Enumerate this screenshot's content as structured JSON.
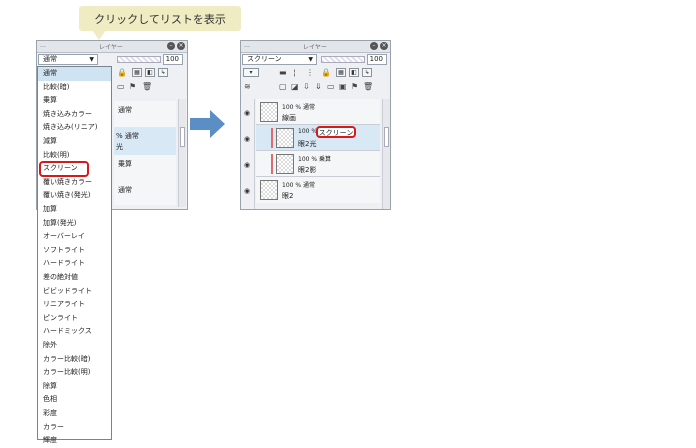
{
  "callout": {
    "text": "クリックしてリストを表示"
  },
  "left_panel": {
    "title_prefix": "…",
    "title": "レイヤー",
    "blend_mode": "通常",
    "opacity": "100",
    "layers_behind": [
      {
        "text_top": "通常"
      },
      {
        "text_top": "% 通常",
        "text_bottom": "光"
      },
      {
        "text_top": "乗算"
      },
      {
        "text_top": "通常"
      }
    ]
  },
  "dropdown": {
    "selected_value": "スクリーン",
    "items": [
      "通常",
      "比較(暗)",
      "乗算",
      "焼き込みカラー",
      "焼き込み(リニア)",
      "減算",
      "比較(明)",
      "スクリーン",
      "覆い焼きカラー",
      "覆い焼き(発光)",
      "加算",
      "加算(発光)",
      "オーバーレイ",
      "ソフトライト",
      "ハードライト",
      "差の絶対値",
      "ビビッドライト",
      "リニアライト",
      "ピンライト",
      "ハードミックス",
      "除外",
      "カラー比較(暗)",
      "カラー比較(明)",
      "除算",
      "色相",
      "彩度",
      "カラー",
      "輝度"
    ]
  },
  "right_panel": {
    "title_prefix": "…",
    "title": "レイヤー",
    "blend_mode": "スクリーン",
    "opacity": "100",
    "layers": [
      {
        "mode": "100 % 通常",
        "name": "線画"
      },
      {
        "mode": "100 %",
        "mode_badge": "スクリーン",
        "name": "眼2光"
      },
      {
        "mode": "100 % 乗算",
        "name": "眼2影"
      },
      {
        "mode": "100 % 通常",
        "name": "眼2"
      }
    ]
  },
  "icons": {
    "eye": "eye-icon",
    "pen": "pen-icon",
    "lock": "lock-icon",
    "trash": "trash-icon",
    "new_layer": "new-layer-icon",
    "folder": "folder-icon",
    "arrow": "right-arrow-icon"
  },
  "colors": {
    "highlight_red": "#d41a1a",
    "selection_blue": "#cfe3f3",
    "callout_bg": "#efecc3",
    "arrow_blue": "#5b8ec4"
  }
}
